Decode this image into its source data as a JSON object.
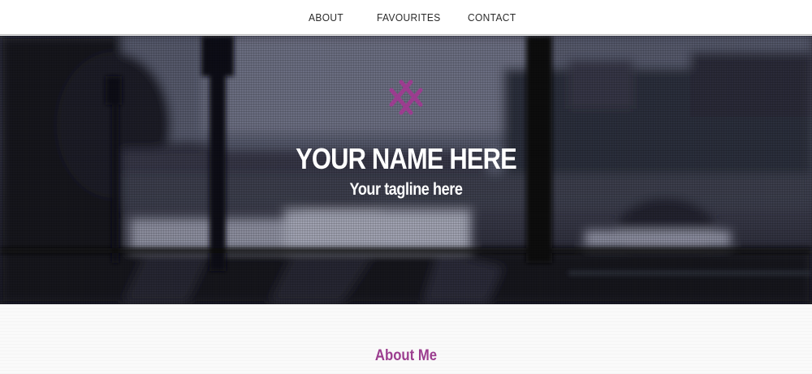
{
  "nav": {
    "items": [
      {
        "label": "ABOUT"
      },
      {
        "label": "FAVOURITES"
      },
      {
        "label": "CONTACT"
      }
    ]
  },
  "hero": {
    "title": "YOUR NAME HERE",
    "tagline": "Your tagline here",
    "logo_icon": "crosshatch-logo-icon",
    "accent_color": "#9b3d8f"
  },
  "about": {
    "heading": "About Me"
  }
}
